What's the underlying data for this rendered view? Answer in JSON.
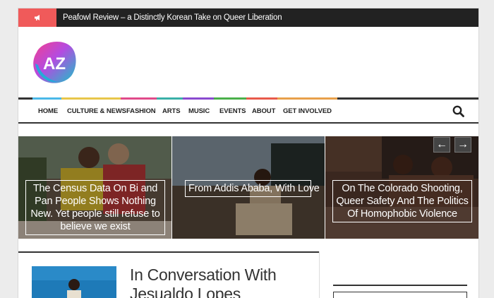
{
  "ticker": {
    "icon": "megaphone-icon",
    "headline": "Peafowl Review – a Distinctly Korean Take on Queer Liberation"
  },
  "logo": {
    "text": "AZ"
  },
  "nav": {
    "items": [
      {
        "label": "HOME"
      },
      {
        "label": "CULTURE & NEWS"
      },
      {
        "label": "FASHION"
      },
      {
        "label": "ARTS"
      },
      {
        "label": "MUSIC"
      },
      {
        "label": "EVENTS"
      },
      {
        "label": "ABOUT"
      },
      {
        "label": "GET INVOLVED"
      }
    ],
    "search_icon": "search-icon",
    "accent_colors": [
      "#4ab8e8",
      "#e8c64a",
      "#e04a8a",
      "#3ab0a8",
      "#8a4ad0",
      "#4ab04a",
      "#e85a4a",
      "#e8a04a"
    ]
  },
  "slider": {
    "prev_icon": "arrow-left-icon",
    "next_icon": "arrow-right-icon",
    "prev_label": "←",
    "next_label": "→",
    "slides": [
      {
        "title": "The Census Data On Bi and Pan People Shows Nothing New. Yet people still refuse to believe we exist"
      },
      {
        "title": "From Addis Ababa, With Love"
      },
      {
        "title": "On The Colorado Shooting, Queer Safety And The Politics Of Homophobic Violence"
      }
    ]
  },
  "featured": {
    "title": "In Conversation With Jesualdo Lopes"
  }
}
